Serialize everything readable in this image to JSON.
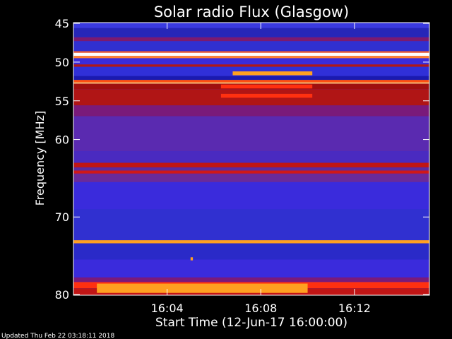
{
  "chart_data": {
    "type": "heatmap",
    "title": "Solar radio Flux (Glasgow)",
    "xlabel": "Start Time (12-Jun-17 16:00:00)",
    "ylabel": "Frequency [MHz]",
    "x_unit": "minutes since 16:00",
    "xlim": [
      0,
      15.2
    ],
    "ylim": [
      80.1,
      44.9
    ],
    "x_ticks": [
      {
        "value": 4,
        "label": "16:04"
      },
      {
        "value": 8,
        "label": "16:08"
      },
      {
        "value": 12,
        "label": "16:12"
      }
    ],
    "y_ticks": [
      {
        "value": 45,
        "label": "45"
      },
      {
        "value": 50,
        "label": "50"
      },
      {
        "value": 55,
        "label": "55"
      },
      {
        "value": 60,
        "label": "60"
      },
      {
        "value": 70,
        "label": "70"
      },
      {
        "value": 80,
        "label": "80"
      }
    ],
    "colormap": [
      "#1a1a9a",
      "#3a2bdc",
      "#6a2a9a",
      "#a01010",
      "#ff3010",
      "#ffa020",
      "#ffffff"
    ],
    "bands": [
      {
        "f1": 44.9,
        "f2": 45.6,
        "color": "#3a3ae0"
      },
      {
        "f1": 45.6,
        "f2": 46.8,
        "color": "#2626b8"
      },
      {
        "f1": 46.8,
        "f2": 47.3,
        "color": "#7a1a70"
      },
      {
        "f1": 47.3,
        "f2": 48.6,
        "color": "#3030d0"
      },
      {
        "f1": 48.6,
        "f2": 48.8,
        "color": "#ff6020"
      },
      {
        "f1": 48.8,
        "f2": 49.2,
        "color": "#ffffff"
      },
      {
        "f1": 49.2,
        "f2": 49.5,
        "color": "#ff8030"
      },
      {
        "f1": 49.5,
        "f2": 50.3,
        "color": "#3a2bdc"
      },
      {
        "f1": 50.3,
        "f2": 50.6,
        "color": "#b01818"
      },
      {
        "f1": 50.6,
        "f2": 51.8,
        "color": "#3030d8"
      },
      {
        "f1": 51.8,
        "f2": 52.3,
        "color": "#1a1ab0"
      },
      {
        "f1": 52.3,
        "f2": 52.6,
        "color": "#ff5010"
      },
      {
        "f1": 52.6,
        "f2": 52.8,
        "color": "#ffb060"
      },
      {
        "f1": 52.8,
        "f2": 53.5,
        "color": "#a01010"
      },
      {
        "f1": 53.5,
        "f2": 55.6,
        "color": "#b01515"
      },
      {
        "f1": 55.6,
        "f2": 57.0,
        "color": "#7a1a7a"
      },
      {
        "f1": 57.0,
        "f2": 61.5,
        "color": "#5a2ab0"
      },
      {
        "f1": 61.5,
        "f2": 63.0,
        "color": "#4a2ac0"
      },
      {
        "f1": 63.0,
        "f2": 63.6,
        "color": "#c01515"
      },
      {
        "f1": 63.6,
        "f2": 64.0,
        "color": "#5a2aa0"
      },
      {
        "f1": 64.0,
        "f2": 64.4,
        "color": "#d01818"
      },
      {
        "f1": 64.4,
        "f2": 65.5,
        "color": "#6a2a9a"
      },
      {
        "f1": 65.5,
        "f2": 69.0,
        "color": "#3a2bdc"
      },
      {
        "f1": 69.0,
        "f2": 73.0,
        "color": "#3030d0"
      },
      {
        "f1": 73.0,
        "f2": 73.4,
        "color": "#ffa020"
      },
      {
        "f1": 73.4,
        "f2": 75.5,
        "color": "#2a2ac8"
      },
      {
        "f1": 75.5,
        "f2": 77.8,
        "color": "#3a2bdc"
      },
      {
        "f1": 77.8,
        "f2": 78.4,
        "color": "#7a1a7a"
      },
      {
        "f1": 78.4,
        "f2": 79.2,
        "color": "#ff3010"
      },
      {
        "f1": 79.2,
        "f2": 80.1,
        "color": "#c01515"
      }
    ],
    "bursts": [
      {
        "t1": 6.8,
        "t2": 10.2,
        "f1": 51.2,
        "f2": 51.7,
        "color": "#ffa020"
      },
      {
        "t1": 6.3,
        "t2": 10.2,
        "f1": 52.9,
        "f2": 53.4,
        "color": "#ff3010"
      },
      {
        "t1": 6.3,
        "t2": 10.2,
        "f1": 54.1,
        "f2": 54.6,
        "color": "#ff3010"
      },
      {
        "t1": 5.0,
        "t2": 5.1,
        "f1": 75.2,
        "f2": 75.6,
        "color": "#ffa020"
      },
      {
        "t1": 1.0,
        "t2": 10.0,
        "f1": 78.6,
        "f2": 79.8,
        "color": "#ffa020"
      }
    ]
  },
  "footer": {
    "updated": "Updated Thu Feb 22 03:18:11 2018"
  }
}
